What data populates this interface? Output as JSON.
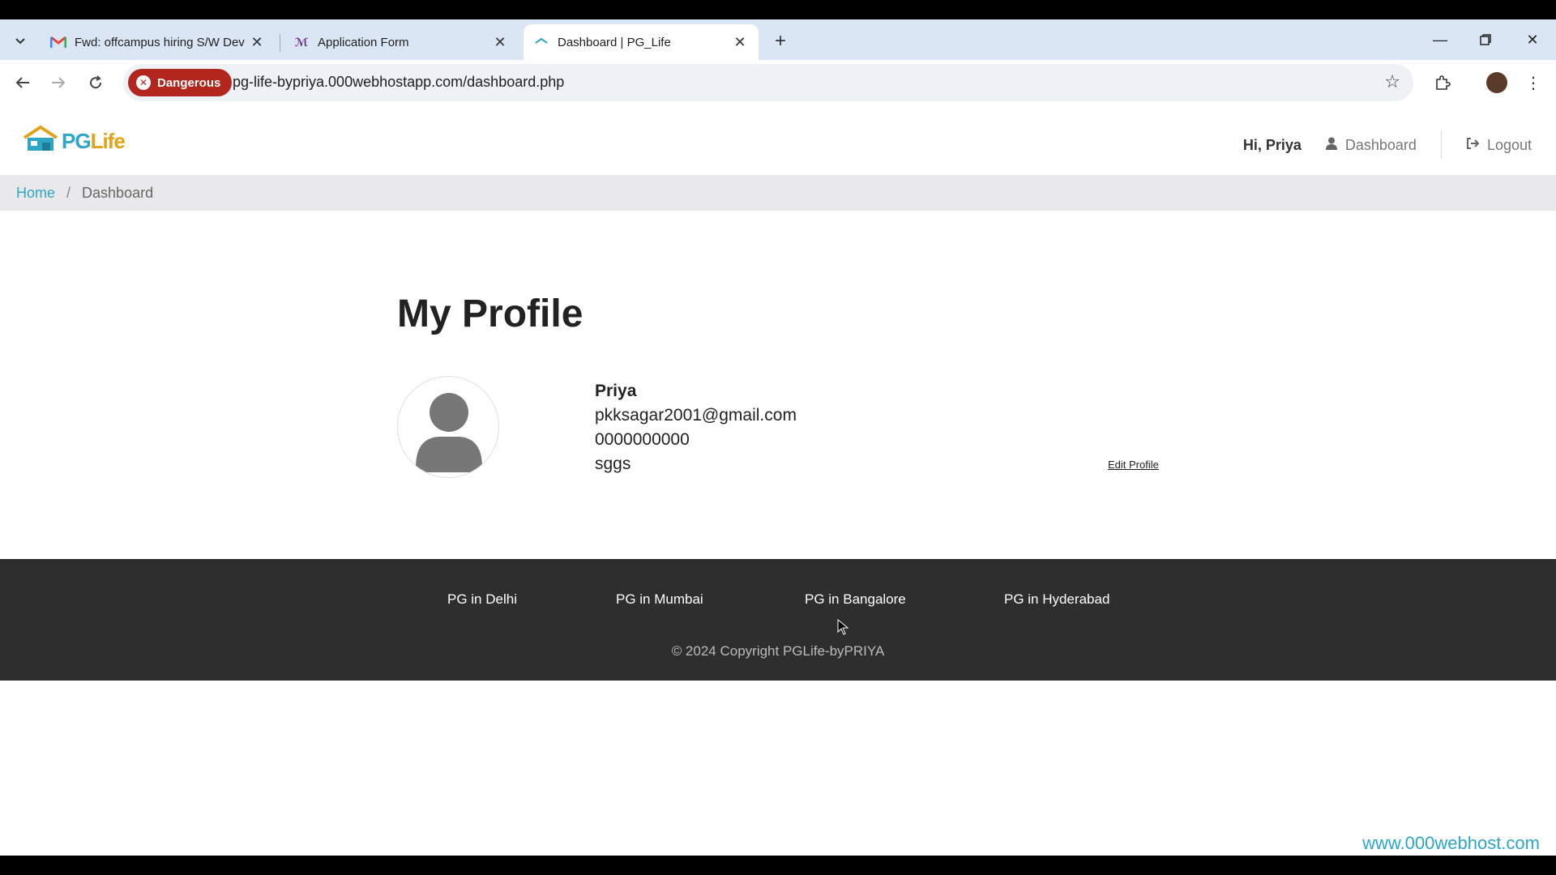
{
  "browser": {
    "tabs": [
      {
        "title": "Fwd: offcampus hiring S/W Dev",
        "favicon": "gmail-icon",
        "active": false
      },
      {
        "title": "Application Form",
        "favicon": "form-icon",
        "active": false
      },
      {
        "title": "Dashboard | PG_Life",
        "favicon": "pglife-icon",
        "active": true
      }
    ],
    "security_chip": "Dangerous",
    "url": "pg-life-bypriya.000webhostapp.com/dashboard.php"
  },
  "header": {
    "logo_text_pg": "PG",
    "logo_text_life": "Life",
    "greeting": "Hi, Priya",
    "dashboard_label": "Dashboard",
    "logout_label": "Logout"
  },
  "breadcrumb": {
    "home": "Home",
    "separator": "/",
    "current": "Dashboard"
  },
  "profile": {
    "title": "My Profile",
    "name": "Priya",
    "email": "pkksagar2001@gmail.com",
    "phone": "0000000000",
    "college": "sggs",
    "edit_label": "Edit Profile"
  },
  "footer": {
    "links": [
      "PG in Delhi",
      "PG in Mumbai",
      "PG in Bangalore",
      "PG in Hyderabad"
    ],
    "copyright": "© 2024 Copyright PGLife-byPRIYA"
  },
  "watermark": "www.000webhost.com",
  "colors": {
    "accent": "#2ea7c7",
    "logo_orange": "#e3a319",
    "danger": "#b3261e",
    "footer_bg": "#2e2e2e"
  }
}
